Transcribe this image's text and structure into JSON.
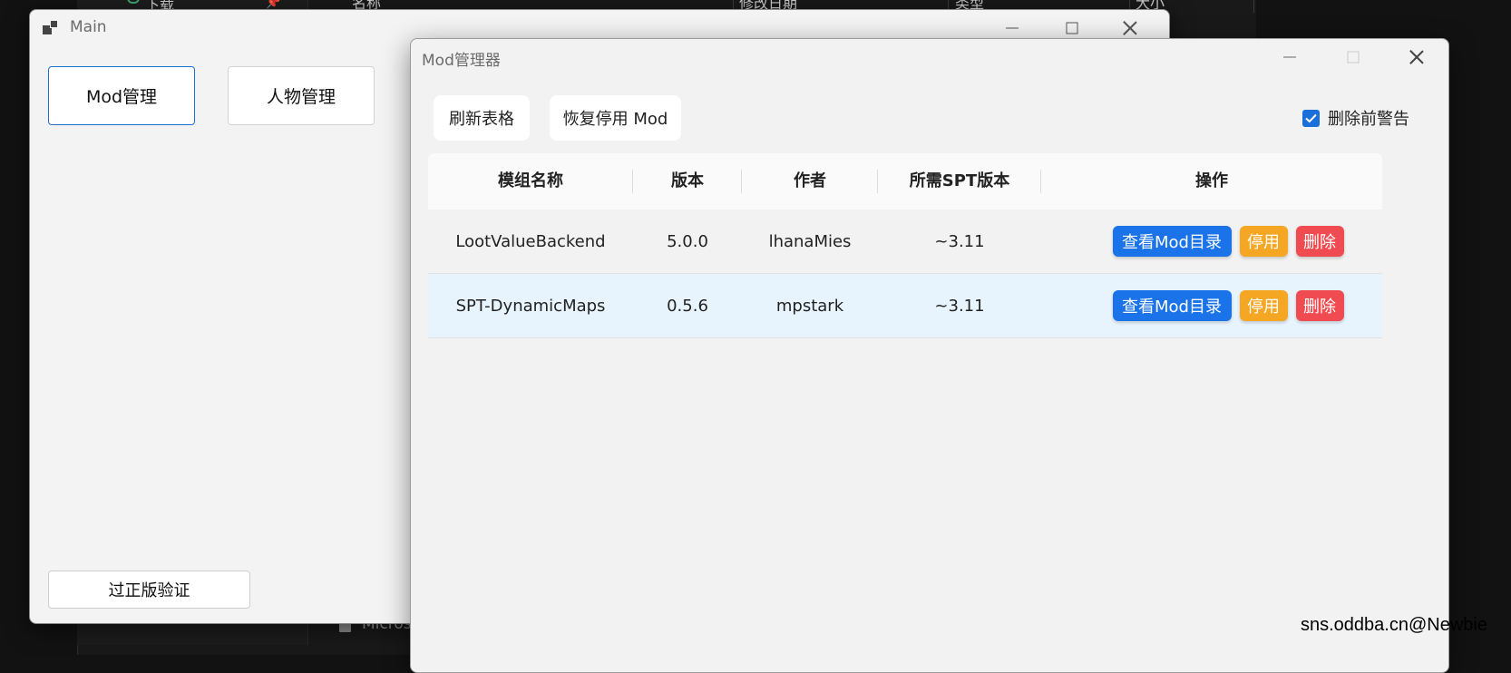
{
  "background": {
    "left_nav_item": "下载",
    "header_cols": [
      "名称",
      "修改日期",
      "类型",
      "大小"
    ],
    "bottom_item": "Micros"
  },
  "main_window": {
    "title": "Main",
    "buttons": {
      "mod_manage": "Mod管理",
      "char_manage": "人物管理",
      "verify": "过正版验证"
    }
  },
  "mod_manager": {
    "title": "Mod管理器",
    "toolbar": {
      "refresh": "刷新表格",
      "restore": "恢复停用 Mod"
    },
    "warn_checkbox": {
      "label": "删除前警告",
      "checked": true
    },
    "table": {
      "headers": [
        "模组名称",
        "版本",
        "作者",
        "所需SPT版本",
        "操作"
      ],
      "rows": [
        {
          "name": "LootValueBackend",
          "version": "5.0.0",
          "author": "lhanaMies",
          "spt": "~3.11"
        },
        {
          "name": "SPT-DynamicMaps",
          "version": "0.5.6",
          "author": "mpstark",
          "spt": "~3.11"
        }
      ],
      "actions": {
        "view": "查看Mod目录",
        "disable": "停用",
        "delete": "删除"
      }
    }
  },
  "watermark": "sns.oddba.cn@Newbie",
  "colors": {
    "accent": "#1a73e8",
    "warning": "#f5a623",
    "danger": "#ef4b50",
    "row_highlight": "#e8f4fd"
  }
}
